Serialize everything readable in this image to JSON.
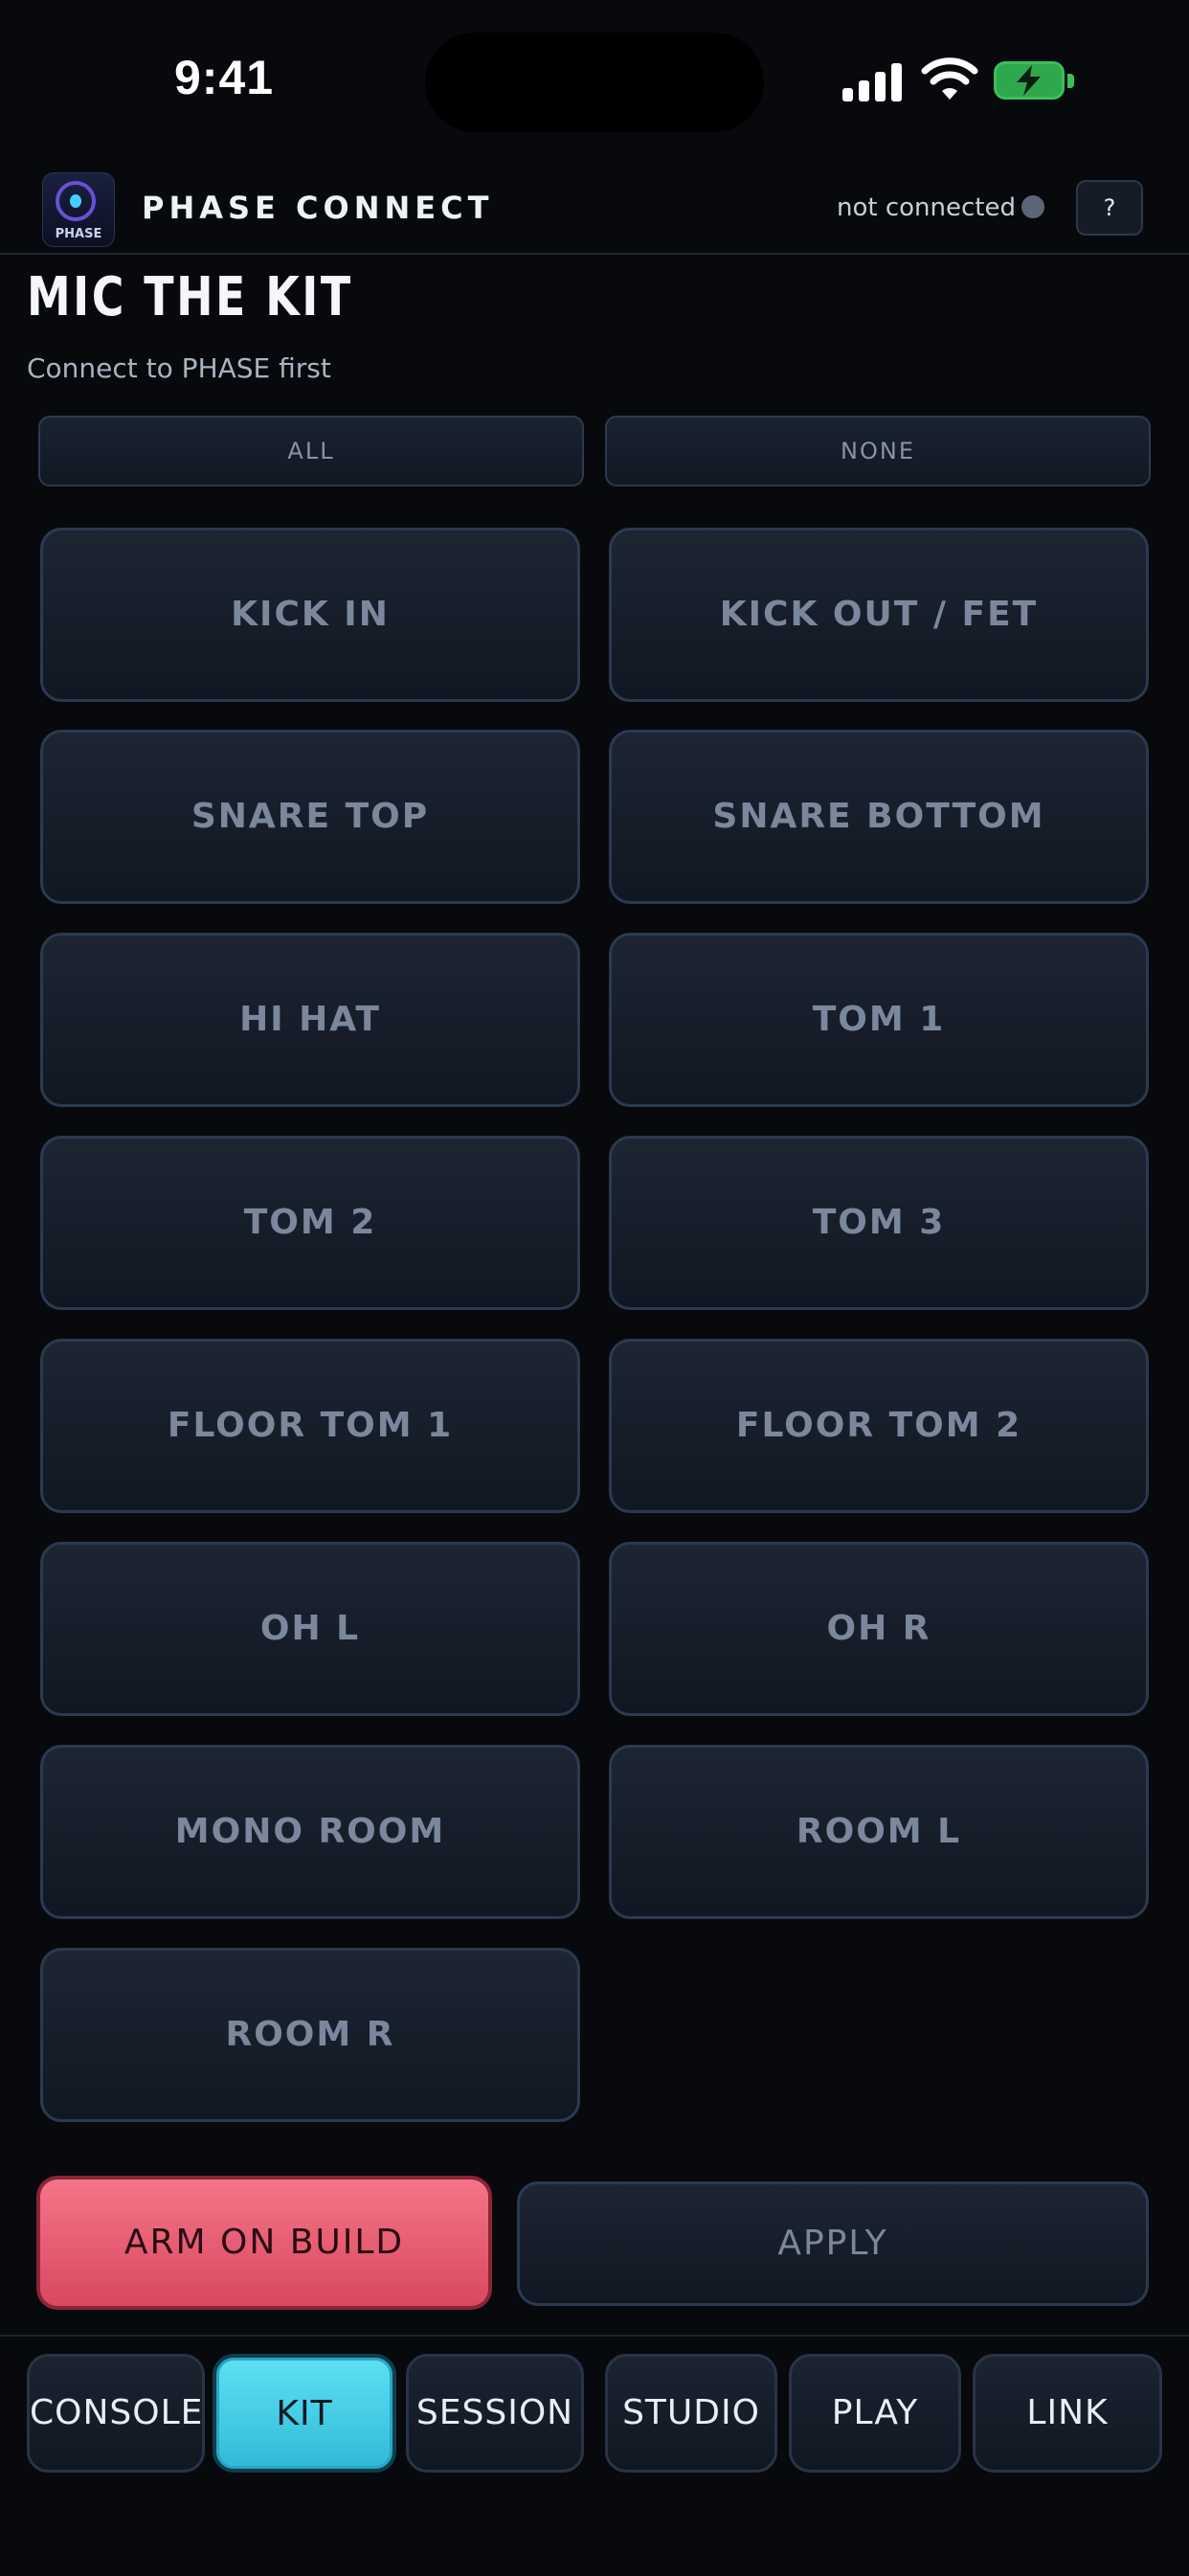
{
  "status_bar": {
    "time": "9:41",
    "signal_icon": "cellular-signal-icon",
    "wifi_icon": "wifi-icon",
    "battery_icon": "battery-charging-icon",
    "battery_color": "#39c05c"
  },
  "header": {
    "logo_text": "PHASE",
    "title": "PHASE CONNECT",
    "connection_status": "not connected",
    "connection_dot_color": "#5c6575",
    "help_label": "?"
  },
  "page": {
    "title": "MIC THE KIT",
    "subtitle": "Connect to PHASE first"
  },
  "selection": {
    "all_label": "ALL",
    "none_label": "NONE"
  },
  "mics": [
    "KICK IN",
    "KICK OUT / FET",
    "SNARE TOP",
    "SNARE BOTTOM",
    "HI HAT",
    "TOM 1",
    "TOM 2",
    "TOM 3",
    "FLOOR TOM 1",
    "FLOOR TOM 2",
    "OH L",
    "OH R",
    "MONO ROOM",
    "ROOM L",
    "ROOM R"
  ],
  "actions": {
    "arm_label": "ARM ON BUILD",
    "apply_label": "APPLY",
    "arm_color": "#e95c72"
  },
  "tabs": [
    {
      "label": "CONSOLE",
      "active": false
    },
    {
      "label": "KIT",
      "active": true
    },
    {
      "label": "SESSION",
      "active": false
    },
    {
      "label": "STUDIO",
      "active": false
    },
    {
      "label": "PLAY",
      "active": false
    },
    {
      "label": "LINK",
      "active": false
    }
  ],
  "colors": {
    "active_tab": "#3fc8e2",
    "background": "#07090d"
  }
}
